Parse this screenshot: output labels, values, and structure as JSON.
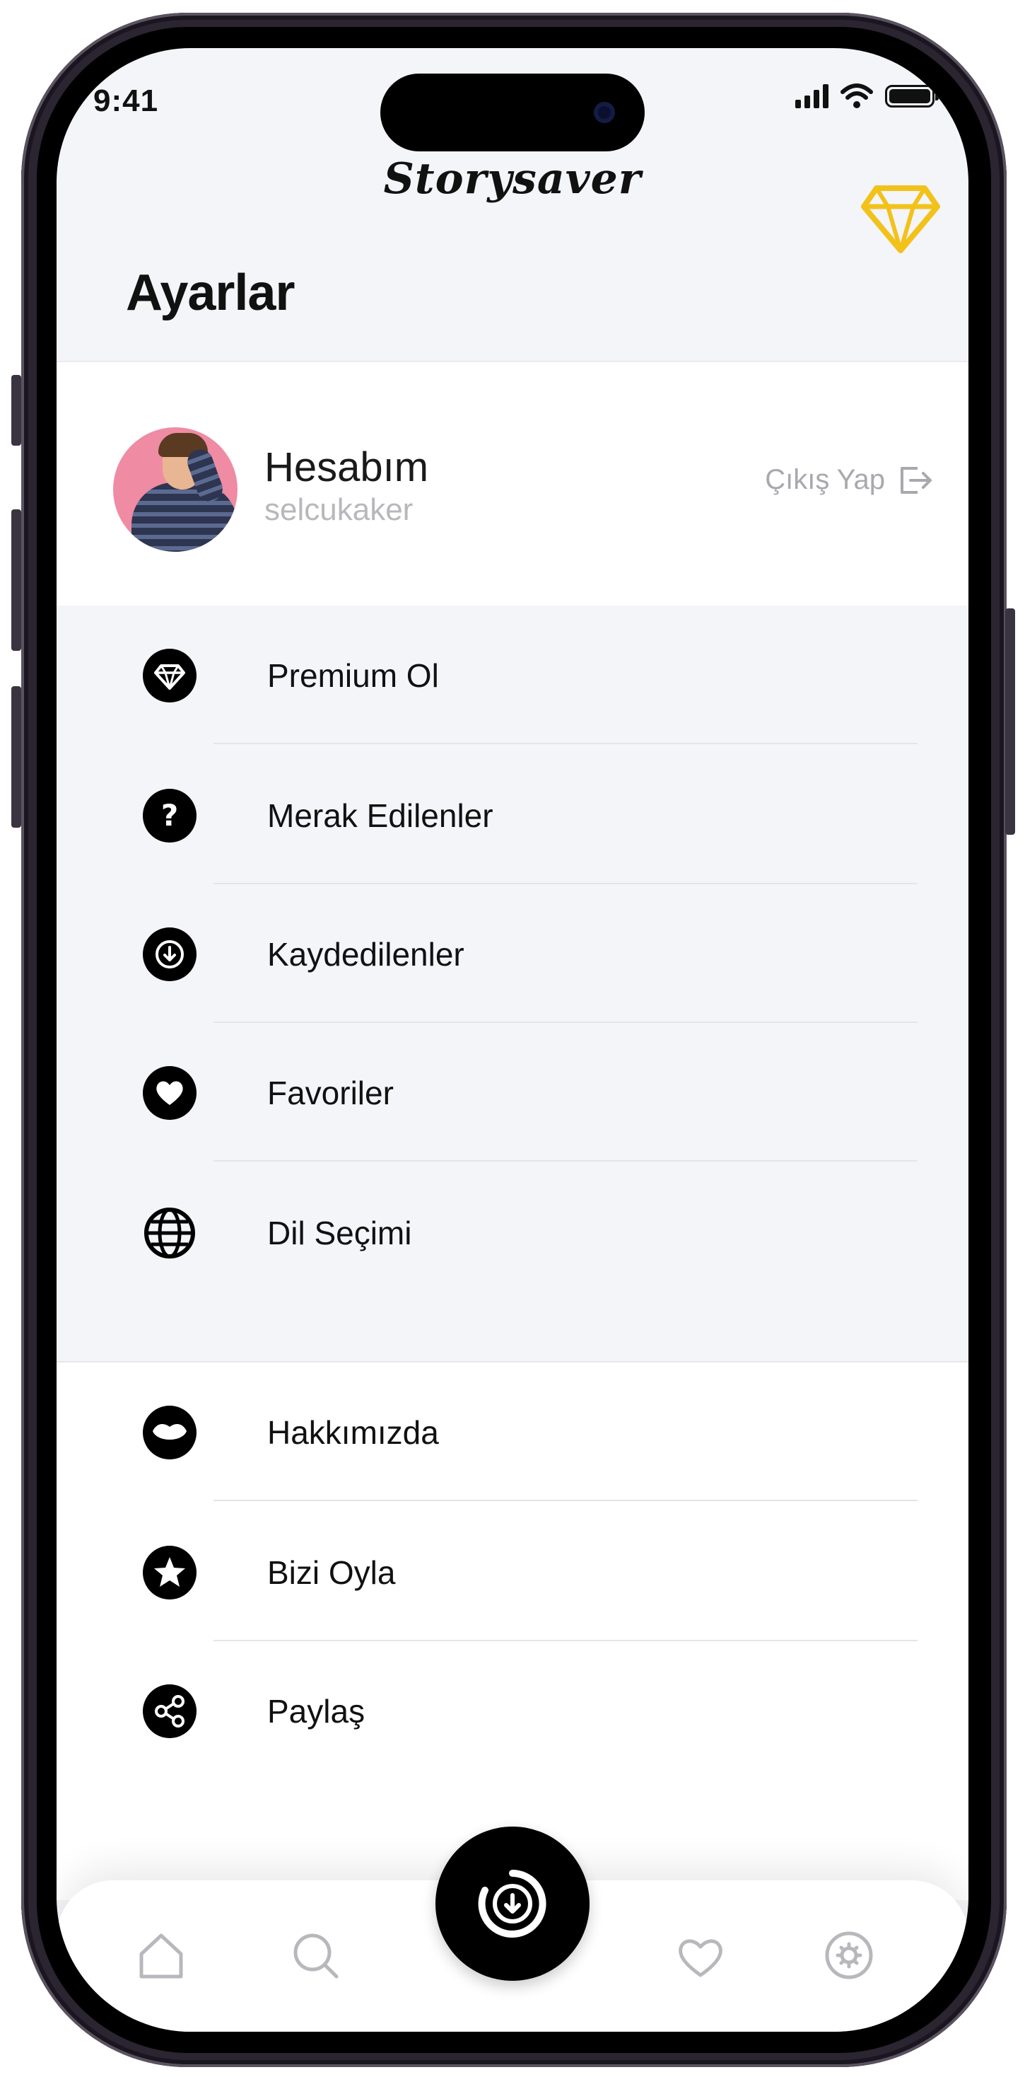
{
  "status_bar": {
    "time": "9:41"
  },
  "header": {
    "logo": "Storysaver",
    "title": "Ayarlar",
    "premium_icon": "diamond-icon",
    "premium_color": "#f2c21b"
  },
  "account": {
    "name": "Hesabım",
    "username": "selcukaker",
    "logout_label": "Çıkış Yap"
  },
  "menu_primary": [
    {
      "label": "Premium Ol",
      "icon": "diamond-icon"
    },
    {
      "label": "Merak Edilenler",
      "icon": "question-icon"
    },
    {
      "label": "Kaydedilenler",
      "icon": "download-circle-icon"
    },
    {
      "label": "Favoriler",
      "icon": "heart-icon"
    },
    {
      "label": "Dil Seçimi",
      "icon": "globe-icon"
    }
  ],
  "menu_secondary": [
    {
      "label": "Hakkımızda",
      "icon": "lips-icon"
    },
    {
      "label": "Bizi Oyla",
      "icon": "star-icon"
    },
    {
      "label": "Paylaş",
      "icon": "share-icon"
    }
  ],
  "tab_bar": {
    "items": [
      "home-icon",
      "search-icon",
      "download-icon",
      "heart-icon",
      "settings-icon"
    ],
    "active": "settings-icon"
  }
}
